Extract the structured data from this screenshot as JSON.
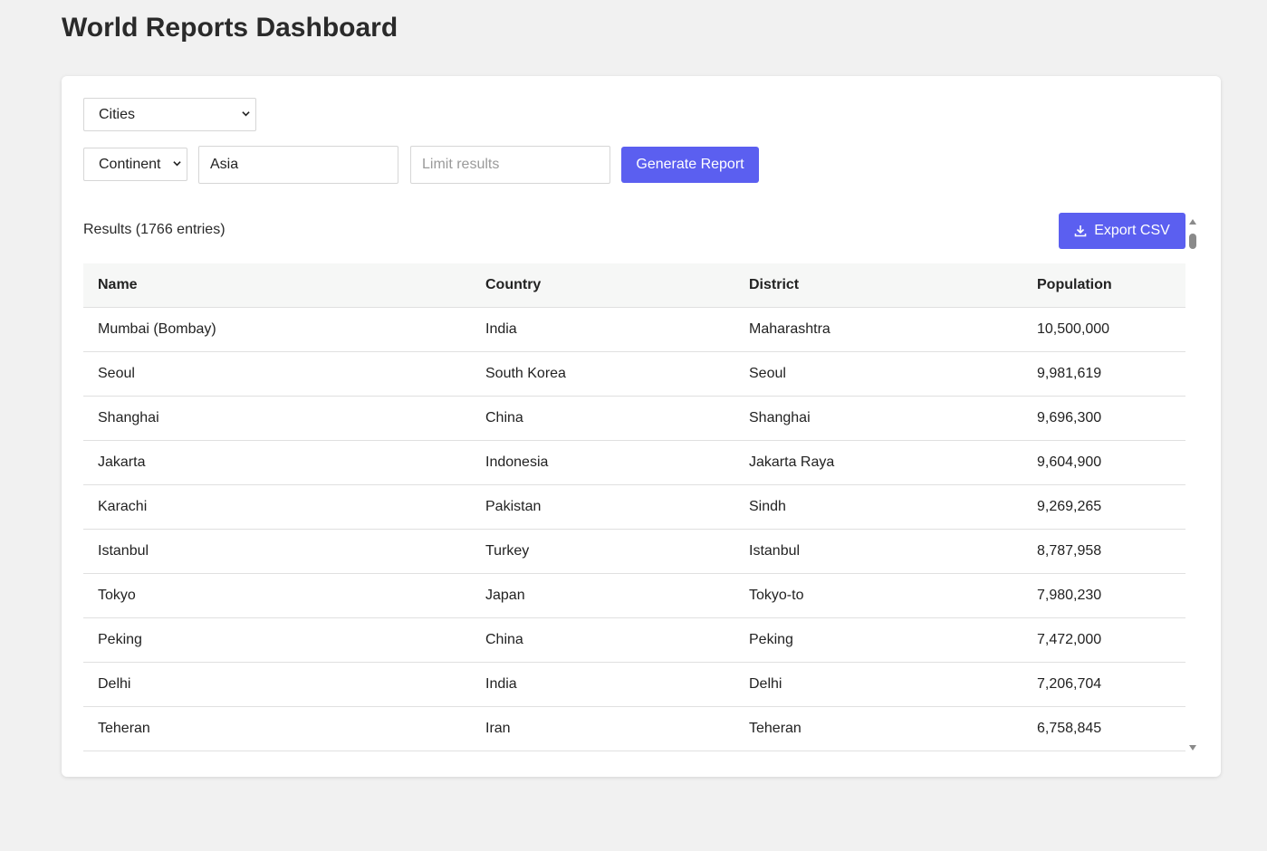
{
  "page": {
    "title": "World Reports Dashboard"
  },
  "controls": {
    "report_type": "Cities",
    "filter_type": "Continent",
    "filter_value": "Asia",
    "limit_placeholder": "Limit results",
    "limit_value": "",
    "generate_label": "Generate Report"
  },
  "results": {
    "summary": "Results (1766 entries)",
    "export_label": "Export CSV",
    "columns": [
      "Name",
      "Country",
      "District",
      "Population"
    ],
    "rows": [
      [
        "Mumbai (Bombay)",
        "India",
        "Maharashtra",
        "10,500,000"
      ],
      [
        "Seoul",
        "South Korea",
        "Seoul",
        "9,981,619"
      ],
      [
        "Shanghai",
        "China",
        "Shanghai",
        "9,696,300"
      ],
      [
        "Jakarta",
        "Indonesia",
        "Jakarta Raya",
        "9,604,900"
      ],
      [
        "Karachi",
        "Pakistan",
        "Sindh",
        "9,269,265"
      ],
      [
        "Istanbul",
        "Turkey",
        "Istanbul",
        "8,787,958"
      ],
      [
        "Tokyo",
        "Japan",
        "Tokyo-to",
        "7,980,230"
      ],
      [
        "Peking",
        "China",
        "Peking",
        "7,472,000"
      ],
      [
        "Delhi",
        "India",
        "Delhi",
        "7,206,704"
      ],
      [
        "Teheran",
        "Iran",
        "Teheran",
        "6,758,845"
      ]
    ]
  },
  "colors": {
    "accent": "#5b5ff0",
    "background": "#f1f1f1",
    "header_row": "#f6f7f6"
  },
  "icons": {
    "export": "download-icon",
    "select": "chevron-down-icon"
  }
}
